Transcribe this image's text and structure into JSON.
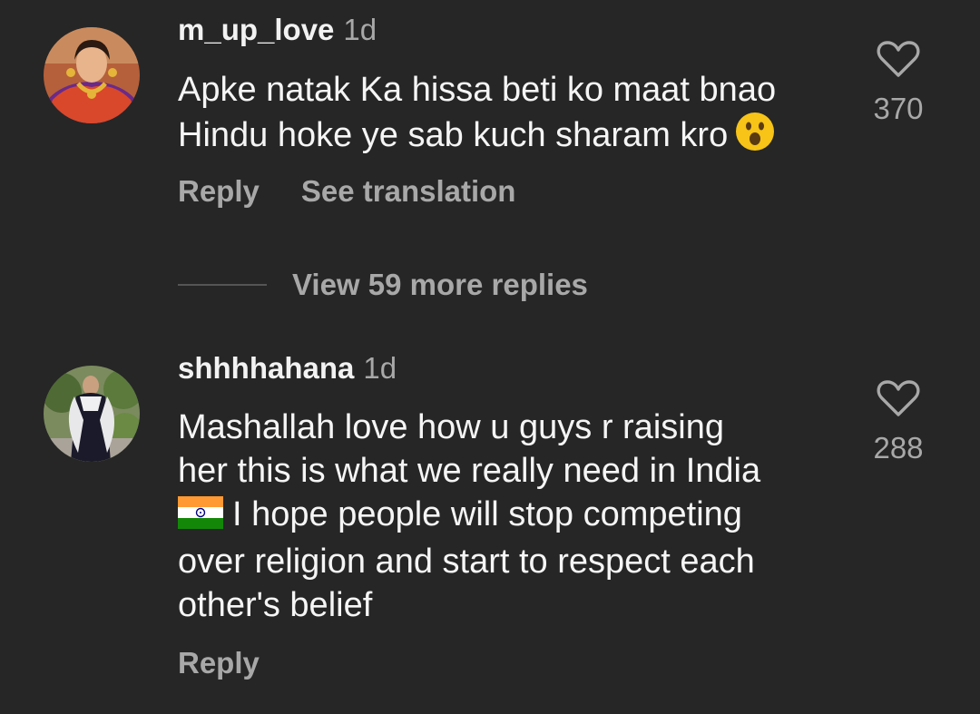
{
  "comments": [
    {
      "username": "m_up_love",
      "time": "1d",
      "text_line1": "Apke natak Ka hissa beti ko maat bnao",
      "text_line2": "Hindu hoke ye sab kuch sharam kro",
      "emoji": "hushed-face-emoji",
      "likes": "370",
      "reply_label": "Reply",
      "translation_label": "See translation"
    },
    {
      "username": "shhhhahana",
      "time": "1d",
      "text_line1": "Mashallah love how u guys r raising",
      "text_line2": "her this is what we really need in India",
      "text_line3": "I hope people will stop competing",
      "text_line4": "over religion and start to respect each",
      "text_line5": "other's belief",
      "emoji": "india-flag-emoji",
      "likes": "288",
      "reply_label": "Reply"
    }
  ],
  "view_more_replies": "View 59 more replies",
  "colors": {
    "background": "#262626",
    "primary_text": "#f5f5f5",
    "secondary_text": "#a8a8a8"
  },
  "icons": {
    "like": "heart-outline-icon"
  }
}
